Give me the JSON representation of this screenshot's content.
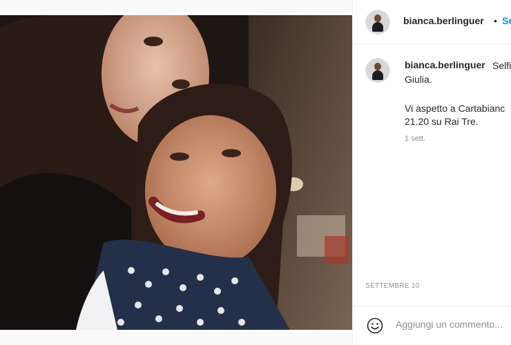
{
  "post": {
    "photo_alt": "selfie",
    "header": {
      "username": "bianca.berlinguer",
      "separator": "•",
      "follow_label": "Se"
    },
    "caption": {
      "username": "bianca.berlinguer",
      "line1": "Selfi",
      "line2": "Giulia.",
      "line3": "Vi aspetto a Cartabianc",
      "line4": "21.20 su Rai Tre."
    },
    "time_ago": "1 sett.",
    "date": "SETTEMBRE 10",
    "comment_placeholder": "Aggiungi un commento...",
    "icons": {
      "emoji": "smiley-icon"
    }
  }
}
